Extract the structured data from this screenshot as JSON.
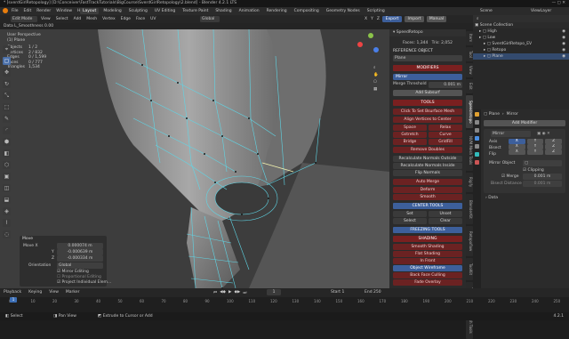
{
  "window": {
    "title": "* [sverdGirlRetopology] [D:\\Conceiver\\FastTrackTutorials\\BigCourse\\SverdGirlRetopology\\2.blend] - Blender 4.2.1 LTS"
  },
  "menus": [
    "File",
    "Edit",
    "Render",
    "Window",
    "Help"
  ],
  "workspaces": [
    "Layout",
    "Modeling",
    "Sculpting",
    "UV Editing",
    "Texture Paint",
    "Shading",
    "Animation",
    "Rendering",
    "Compositing",
    "Geometry Nodes",
    "Scripting"
  ],
  "top_right": {
    "scene": "Scene",
    "view_layer": "ViewLayer"
  },
  "header": {
    "mode": "Edit Mode",
    "menus": [
      "View",
      "Select",
      "Add",
      "Mesh",
      "Vertex",
      "Edge",
      "Face",
      "UV"
    ],
    "orientation": "Global",
    "xyz": [
      "X",
      "Y",
      "Z"
    ],
    "export": "Export",
    "import": "Import",
    "manual": "Manual"
  },
  "toolbar_row2": {
    "label": "Data  L_Smoothness  0.00"
  },
  "viewport_info": {
    "line1": "User Perspective",
    "line2": "(1) Plane",
    "stats": [
      {
        "k": "Objects",
        "v": "1 / 2"
      },
      {
        "k": "Vertices",
        "v": "2 / 832"
      },
      {
        "k": "Edges",
        "v": "0 / 1,599"
      },
      {
        "k": "Faces",
        "v": "0 / 777"
      },
      {
        "k": "Triangles",
        "v": "1,534"
      }
    ]
  },
  "left_tools": [
    "⌖",
    "▢",
    "✥",
    "↻",
    "⤡",
    "⬚",
    "✎",
    "◜",
    "⬢",
    "◧",
    "⬡",
    "▣",
    "◫",
    "⬓",
    "◈",
    "⌇",
    "◌"
  ],
  "move_panel": {
    "title": "Move",
    "move_x_label": "Move X",
    "move_x": "0.000074 m",
    "y_label": "Y",
    "y": "-0.000639 m",
    "z_label": "Z",
    "z": "-0.000334 m",
    "orientation_label": "Orientation",
    "orientation": "Global",
    "mirror_editing": "Mirror Editing",
    "proportional_editing": "Proportional Editing",
    "project_individual": "Project Individual Elem..."
  },
  "speedretopo": {
    "header": "SpeedRetopo",
    "faces": "Faces: 1,344",
    "tris": "Tris: 2,052",
    "reference_object_label": "REFERENCE OBJECT",
    "reference_object": "Plane",
    "modifiers_label": "MODIFIERS",
    "mirror_label": "Mirror",
    "merge_threshold_label": "Merge Threshold",
    "merge_threshold": "0.001 m",
    "add_subsurf": "Add Subsurf",
    "tools_label": "TOOLS",
    "tool_buttons": [
      "Click To Set Bsurface Mesh",
      "Align Vertices to Center"
    ],
    "grid_buttons": [
      [
        "Space",
        "Relax"
      ],
      [
        "Gstretch",
        "Curve"
      ],
      [
        "Bridge",
        "GridFill"
      ]
    ],
    "remove_doubles": "Remove Doubles",
    "normals_buttons": [
      "Recalculate Normals Outside",
      "Recalculate Normals Inside",
      "Flip Normals"
    ],
    "auto_merge": "Auto Merge",
    "deform": "Deform",
    "smooth": "Smooth",
    "center_tools_label": "CENTER TOOLS",
    "center_grid": [
      [
        "Set",
        "Unset"
      ],
      [
        "Select",
        "Clear"
      ]
    ],
    "freezing_tools_label": "FREEZING TOOLS",
    "shading_label": "SHADING",
    "shading_buttons": [
      "Smooth Shading",
      "Flat Shading",
      "In Front",
      "Object Wireframe",
      "Back Face Culling",
      "Fade Overlay"
    ]
  },
  "npanel_tabs": [
    "Item",
    "Tool",
    "View",
    "Edit",
    "Speedretopo",
    "NVM Mesh Tools",
    "Rigify",
    "BlenderKit",
    "Retopoflow",
    "ToolKit",
    "Textures",
    "Mesh Tools"
  ],
  "outliner": {
    "title": "Scene Collection",
    "items": [
      {
        "label": "High",
        "indent": 1
      },
      {
        "label": "Low",
        "indent": 1
      },
      {
        "label": "SverdGirlRetopo_EV",
        "indent": 2
      },
      {
        "label": "Retopo",
        "indent": 2
      },
      {
        "label": "Plane",
        "indent": 2
      }
    ]
  },
  "properties": {
    "breadcrumb_obj": "Plane",
    "breadcrumb_mod": "Mirror",
    "add_modifier": "Add Modifier",
    "modifier_name": "Mirror",
    "axis_label": "Axis",
    "bisect_label": "Bisect",
    "flip_label": "Flip",
    "axes": [
      "X",
      "Y",
      "Z"
    ],
    "mirror_object_label": "Mirror Object",
    "clipping_label": "Clipping",
    "merge_label": "Merge",
    "merge_value": "0.001 m",
    "bisect_distance_label": "Bisect Distance",
    "bisect_distance": "0.001 m",
    "data_label": "Data"
  },
  "timeline": {
    "playback": "Playback",
    "keying": "Keying",
    "view": "View",
    "marker": "Marker",
    "current_frame": "1",
    "start_label": "Start",
    "start": "1",
    "end_label": "End",
    "end": "250",
    "ticks": [
      "0",
      "10",
      "20",
      "30",
      "40",
      "50",
      "60",
      "70",
      "80",
      "90",
      "100",
      "110",
      "120",
      "130",
      "140",
      "150",
      "160",
      "170",
      "180",
      "190",
      "200",
      "210",
      "220",
      "230",
      "240",
      "250"
    ]
  },
  "statusbar": {
    "select": "Select",
    "pan_view": "Pan View",
    "extrude": "Extrude to Cursor or Add",
    "version": "4.2.1"
  }
}
